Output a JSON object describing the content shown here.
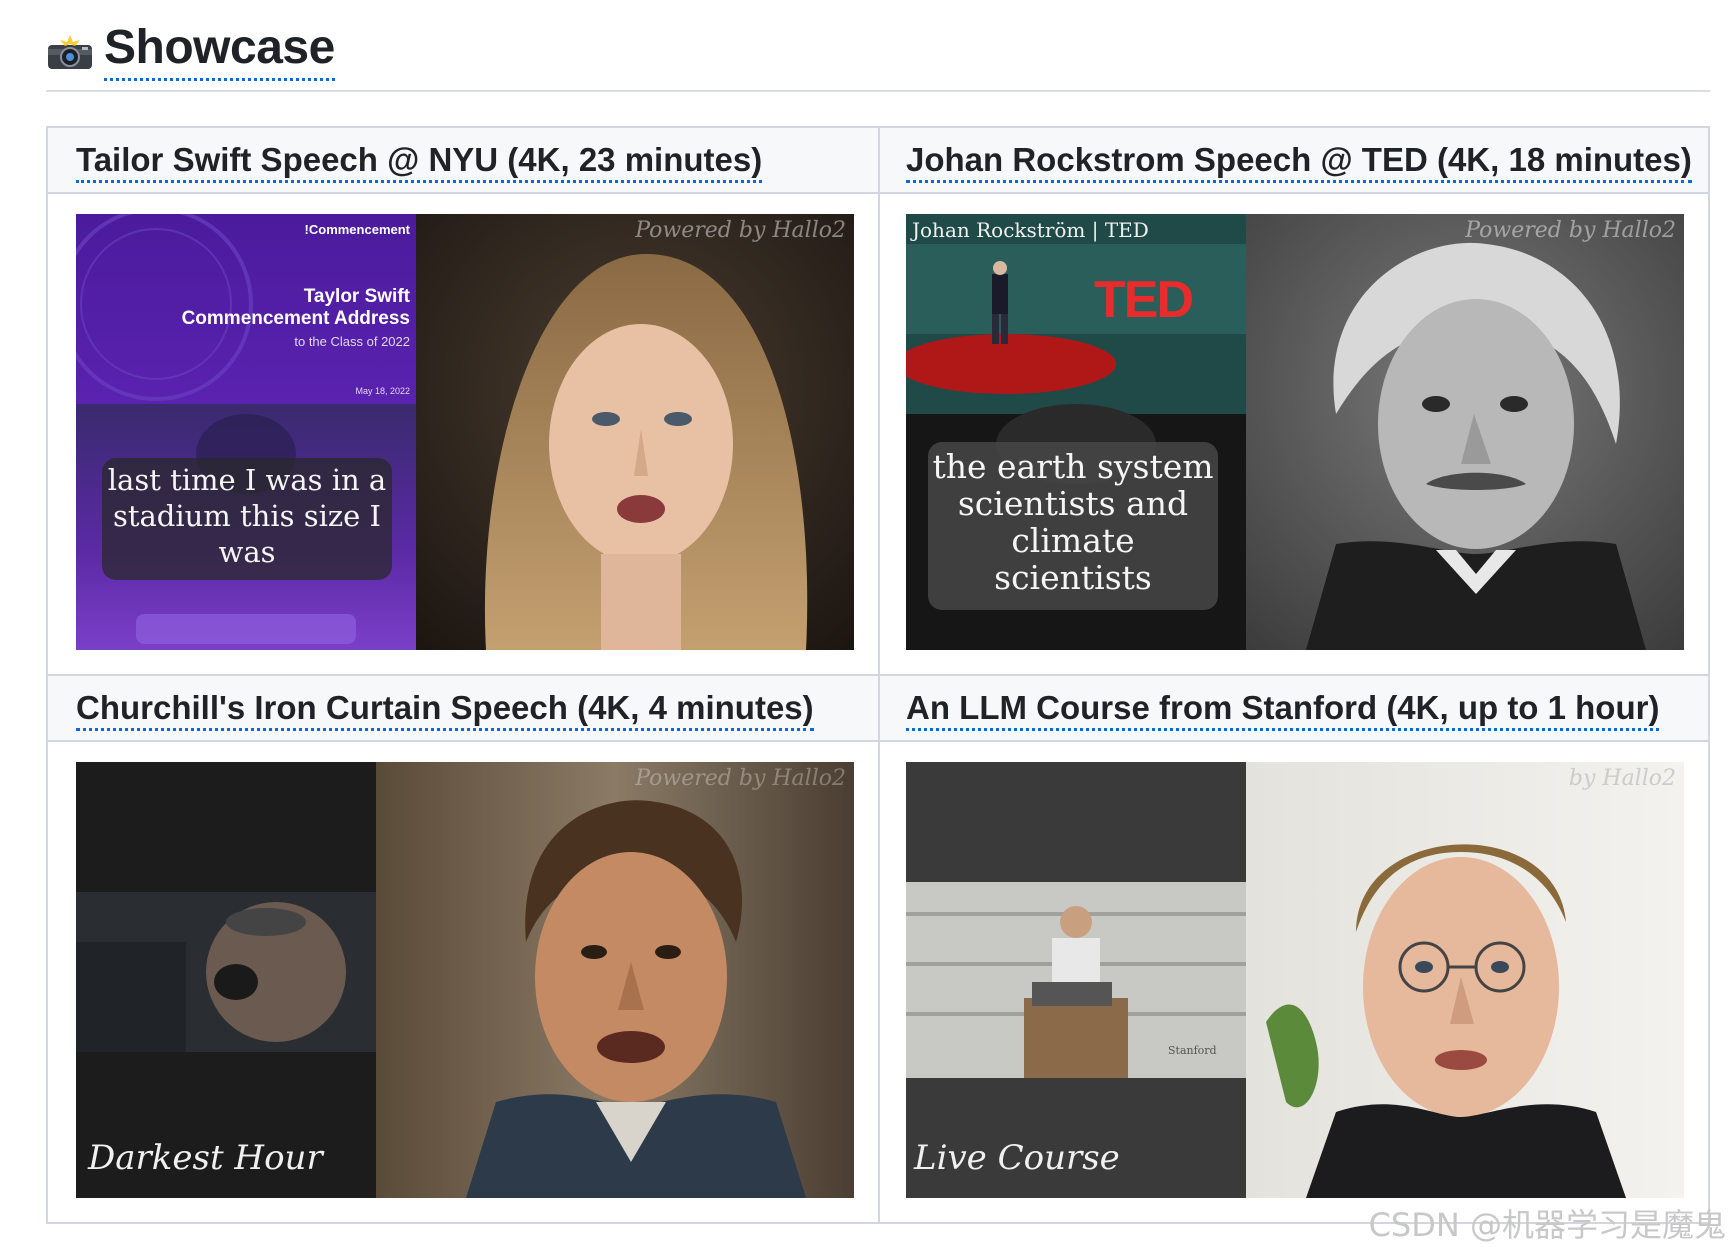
{
  "heading": {
    "title": "Showcase",
    "icon": "camera-flash-icon"
  },
  "cells": [
    {
      "title": "Tailor Swift Speech @ NYU (4K, 23 minutes)",
      "watermark": "Powered by Hallo2",
      "slide_tag": "!Commencement",
      "slide_name": "Taylor Swift",
      "slide_event": "Commencement Address",
      "slide_class": "to the Class of 2022",
      "slide_date": "May 18, 2022",
      "caption": "last time I was in a stadium this size I was"
    },
    {
      "title": "Johan Rockstrom Speech @ TED (4K, 18 minutes)",
      "watermark": "Powered by Hallo2",
      "video_label": "Johan Rockström | TED",
      "logo": "TED",
      "caption": "the earth system scientists and climate scientists"
    },
    {
      "title": "Churchill's Iron Curtain Speech (4K, 4 minutes)",
      "watermark": "Powered by Hallo2",
      "caption": "Darkest Hour"
    },
    {
      "title": "An LLM Course from Stanford (4K, up to 1 hour)",
      "watermark": "by Hallo2",
      "room_sign": "Stanford",
      "caption": "Live Course"
    }
  ],
  "footer": {
    "watermark": "CSDN @机器学习是魔鬼"
  }
}
